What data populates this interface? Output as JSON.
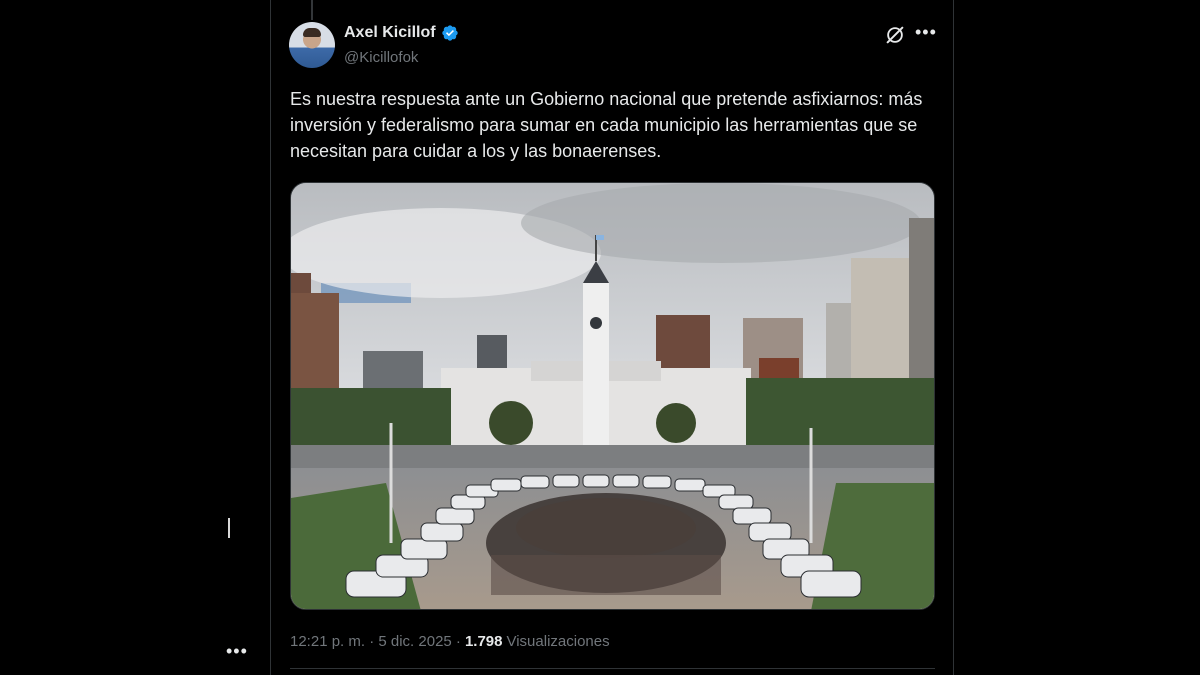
{
  "tweet": {
    "author": {
      "display_name": "Axel Kicillof",
      "handle": "@Kicillofok",
      "verified": true
    },
    "text": "Es nuestra respuesta ante un Gobierno nacional que pretende asfixiarnos: más inversión y federalismo para sumar en cada municipio las herramientas que se necesitan para cuidar a los y las bonaerenses.",
    "timestamp": "12:21 p. m. · 5 dic. 2025 ·",
    "views_count": "1.798",
    "views_label": "Visualizaciones"
  },
  "icons": {
    "verified": "verified-badge-icon",
    "grok": "grok-icon",
    "more": "more-options-icon"
  },
  "colors": {
    "background": "#000000",
    "text_primary": "#e7e9ea",
    "text_secondary": "#71767b",
    "verified_blue": "#1d9bf0",
    "border": "#2f3336"
  }
}
